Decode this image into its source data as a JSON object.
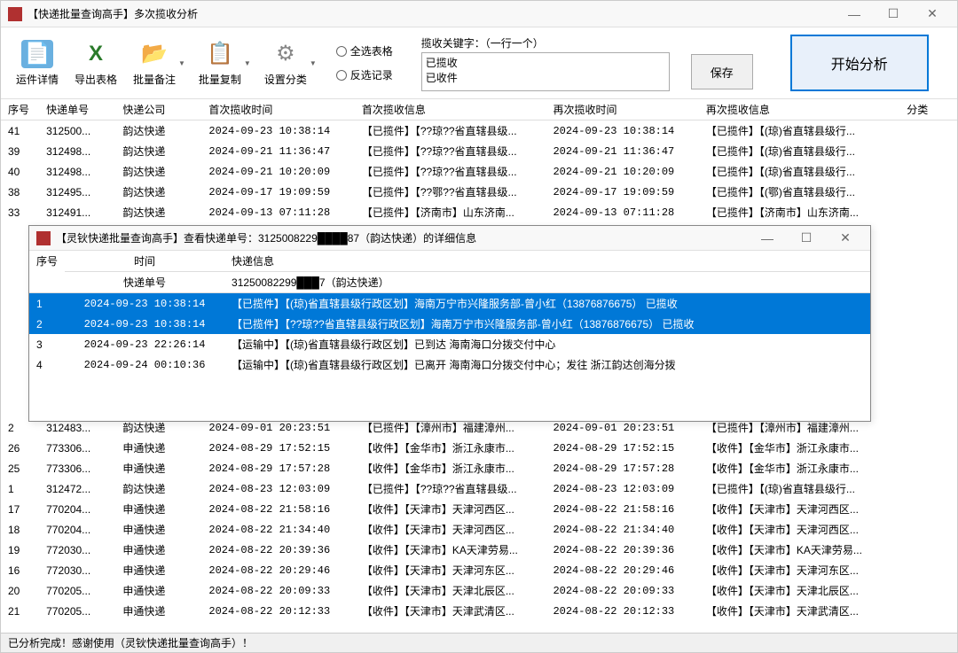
{
  "main_window": {
    "title": "【快递批量查询高手】多次揽收分析"
  },
  "toolbar": {
    "detail": "运件详情",
    "export": "导出表格",
    "batch_note": "批量备注",
    "batch_copy": "批量复制",
    "settings": "设置分类"
  },
  "radio": {
    "select_all": "全选表格",
    "invert": "反选记录"
  },
  "keyword": {
    "label": "揽收关键字：（一行一个）",
    "value": "已揽收\n已收件"
  },
  "buttons": {
    "save": "保存",
    "analyze": "开始分析"
  },
  "columns": {
    "seq": "序号",
    "num": "快递单号",
    "company": "快递公司",
    "first_time": "首次揽收时间",
    "first_info": "首次揽收信息",
    "again_time": "再次揽收时间",
    "again_info": "再次揽收信息",
    "category": "分类"
  },
  "rows": [
    {
      "seq": "41",
      "num": "312500...",
      "comp": "韵达快递",
      "t1": "2024-09-23 10:38:14",
      "i1": "【已揽件】【??琼??省直辖县级...",
      "t2": "2024-09-23 10:38:14",
      "i2": "【已揽件】【(琼)省直辖县级行..."
    },
    {
      "seq": "39",
      "num": "312498...",
      "comp": "韵达快递",
      "t1": "2024-09-21 11:36:47",
      "i1": "【已揽件】【??琼??省直辖县级...",
      "t2": "2024-09-21 11:36:47",
      "i2": "【已揽件】【(琼)省直辖县级行..."
    },
    {
      "seq": "40",
      "num": "312498...",
      "comp": "韵达快递",
      "t1": "2024-09-21 10:20:09",
      "i1": "【已揽件】【??琼??省直辖县级...",
      "t2": "2024-09-21 10:20:09",
      "i2": "【已揽件】【(琼)省直辖县级行..."
    },
    {
      "seq": "38",
      "num": "312495...",
      "comp": "韵达快递",
      "t1": "2024-09-17 19:09:59",
      "i1": "【已揽件】【??鄂??省直辖县级...",
      "t2": "2024-09-17 19:09:59",
      "i2": "【已揽件】【(鄂)省直辖县级行..."
    },
    {
      "seq": "33",
      "num": "312491...",
      "comp": "韵达快递",
      "t1": "2024-09-13 07:11:28",
      "i1": "【已揽件】【济南市】山东济南...",
      "t2": "2024-09-13 07:11:28",
      "i2": "【已揽件】【济南市】山东济南..."
    },
    {
      "seq": "",
      "num": "",
      "comp": "",
      "t1": "",
      "i1": "",
      "t2": "",
      "i2": ""
    },
    {
      "seq": "",
      "num": "",
      "comp": "",
      "t1": "",
      "i1": "",
      "t2": "",
      "i2": ""
    },
    {
      "seq": "",
      "num": "",
      "comp": "",
      "t1": "",
      "i1": "",
      "t2": "",
      "i2": ""
    },
    {
      "seq": "",
      "num": "",
      "comp": "",
      "t1": "",
      "i1": "",
      "t2": "",
      "i2": ""
    },
    {
      "seq": "",
      "num": "",
      "comp": "",
      "t1": "",
      "i1": "",
      "t2": "",
      "i2": ""
    },
    {
      "seq": "",
      "num": "",
      "comp": "",
      "t1": "",
      "i1": "",
      "t2": "",
      "i2": ""
    },
    {
      "seq": "",
      "num": "",
      "comp": "",
      "t1": "",
      "i1": "",
      "t2": "",
      "i2": ""
    },
    {
      "seq": "",
      "num": "",
      "comp": "",
      "t1": "",
      "i1": "",
      "t2": "",
      "i2": ""
    },
    {
      "seq": "",
      "num": "",
      "comp": "",
      "t1": "",
      "i1": "",
      "t2": "",
      "i2": ""
    },
    {
      "seq": "",
      "num": "",
      "comp": "",
      "t1": "",
      "i1": "",
      "t2": "",
      "i2": ""
    },
    {
      "seq": "2",
      "num": "312483...",
      "comp": "韵达快递",
      "t1": "2024-09-01 20:23:51",
      "i1": "【已揽件】【漳州市】福建漳州...",
      "t2": "2024-09-01 20:23:51",
      "i2": "【已揽件】【漳州市】福建漳州..."
    },
    {
      "seq": "26",
      "num": "773306...",
      "comp": "申通快递",
      "t1": "2024-08-29 17:52:15",
      "i1": "【收件】【金华市】浙江永康市...",
      "t2": "2024-08-29 17:52:15",
      "i2": "【收件】【金华市】浙江永康市..."
    },
    {
      "seq": "25",
      "num": "773306...",
      "comp": "申通快递",
      "t1": "2024-08-29 17:57:28",
      "i1": "【收件】【金华市】浙江永康市...",
      "t2": "2024-08-29 17:57:28",
      "i2": "【收件】【金华市】浙江永康市..."
    },
    {
      "seq": "1",
      "num": "312472...",
      "comp": "韵达快递",
      "t1": "2024-08-23 12:03:09",
      "i1": "【已揽件】【??琼??省直辖县级...",
      "t2": "2024-08-23 12:03:09",
      "i2": "【已揽件】【(琼)省直辖县级行..."
    },
    {
      "seq": "17",
      "num": "770204...",
      "comp": "申通快递",
      "t1": "2024-08-22 21:58:16",
      "i1": "【收件】【天津市】天津河西区...",
      "t2": "2024-08-22 21:58:16",
      "i2": "【收件】【天津市】天津河西区..."
    },
    {
      "seq": "18",
      "num": "770204...",
      "comp": "申通快递",
      "t1": "2024-08-22 21:34:40",
      "i1": "【收件】【天津市】天津河西区...",
      "t2": "2024-08-22 21:34:40",
      "i2": "【收件】【天津市】天津河西区..."
    },
    {
      "seq": "19",
      "num": "772030...",
      "comp": "申通快递",
      "t1": "2024-08-22 20:39:36",
      "i1": "【收件】【天津市】KA天津劳易...",
      "t2": "2024-08-22 20:39:36",
      "i2": "【收件】【天津市】KA天津劳易..."
    },
    {
      "seq": "16",
      "num": "772030...",
      "comp": "申通快递",
      "t1": "2024-08-22 20:29:46",
      "i1": "【收件】【天津市】天津河东区...",
      "t2": "2024-08-22 20:29:46",
      "i2": "【收件】【天津市】天津河东区..."
    },
    {
      "seq": "20",
      "num": "770205...",
      "comp": "申通快递",
      "t1": "2024-08-22 20:09:33",
      "i1": "【收件】【天津市】天津北辰区...",
      "t2": "2024-08-22 20:09:33",
      "i2": "【收件】【天津市】天津北辰区..."
    },
    {
      "seq": "21",
      "num": "770205...",
      "comp": "申通快递",
      "t1": "2024-08-22 20:12:33",
      "i1": "【收件】【天津市】天津武清区...",
      "t2": "2024-08-22 20:12:33",
      "i2": "【收件】【天津市】天津武清区..."
    }
  ],
  "status": "已分析完成！感谢使用（灵钬快递批量查询高手）！",
  "sub_window": {
    "title": "【灵钬快递批量查询高手】查看快递单号：3125008229████87（韵达快递）的详细信息",
    "columns": {
      "seq": "序号",
      "time": "时间",
      "num_label": "快递单号",
      "num_value": "31250082299███7（韵达快递）",
      "info": "快递信息"
    },
    "rows": [
      {
        "seq": "1",
        "time": "2024-09-23 10:38:14",
        "info": "【已揽件】【(琼)省直辖县级行政区划】海南万宁市兴隆服务部-曾小红（13876876675）  已揽收",
        "selected": true
      },
      {
        "seq": "2",
        "time": "2024-09-23 10:38:14",
        "info": "【已揽件】【??琼??省直辖县级行政区划】海南万宁市兴隆服务部-曾小红（13876876675）  已揽收",
        "selected": true
      },
      {
        "seq": "3",
        "time": "2024-09-23 22:26:14",
        "info": "【运输中】【(琼)省直辖县级行政区划】已到达 海南海口分拨交付中心",
        "selected": false
      },
      {
        "seq": "4",
        "time": "2024-09-24 00:10:36",
        "info": "【运输中】【(琼)省直辖县级行政区划】已离开 海南海口分拨交付中心；发往 浙江韵达创海分拨",
        "selected": false
      }
    ]
  }
}
